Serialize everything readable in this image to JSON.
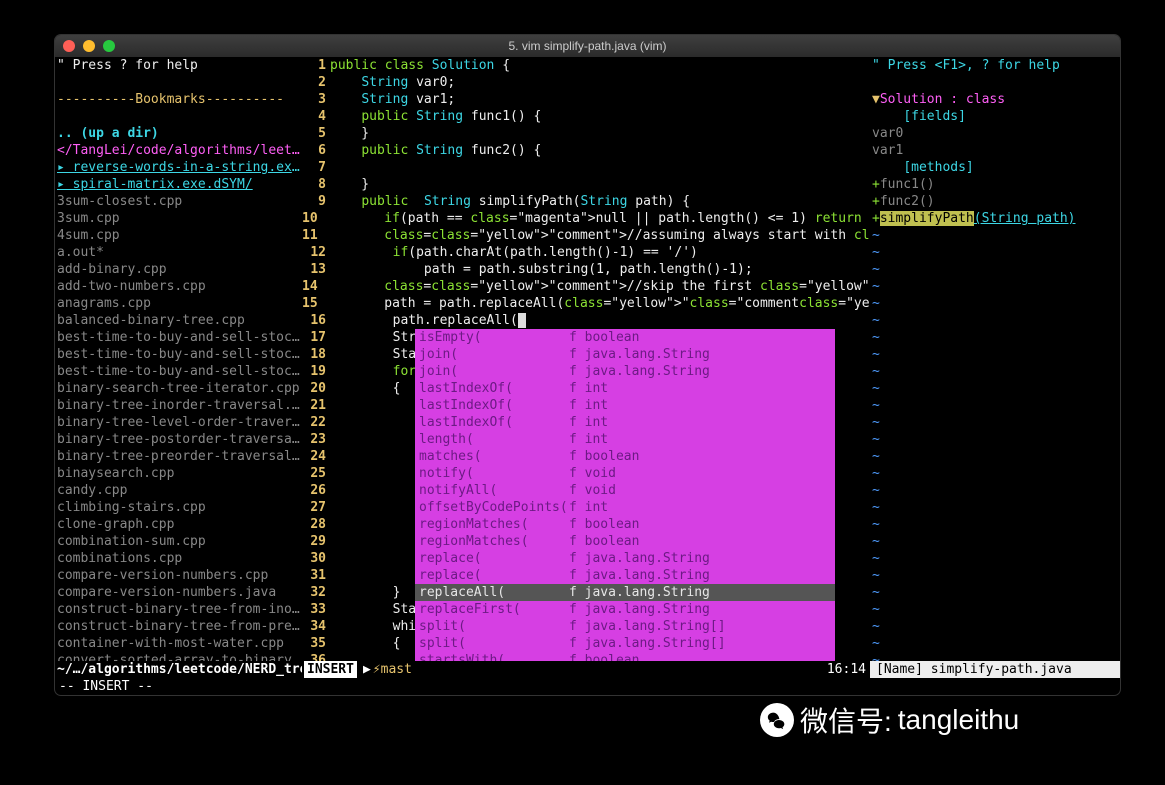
{
  "window": {
    "title": "5. vim simplify-path.java (vim)"
  },
  "nerdtree": {
    "help": "\" Press ? for help",
    "bookmarks": "  ----------Bookmarks----------",
    "up": ".. (up a dir)",
    "root": "</TangLei/code/algorithms/leetcode/",
    "dirs": [
      "▸ reverse-words-in-a-string.exe.dSY",
      "▸ spiral-matrix.exe.dSYM/"
    ],
    "files": [
      "3sum-closest.cpp",
      "3sum.cpp",
      "4sum.cpp",
      "a.out*",
      "add-binary.cpp",
      "add-two-numbers.cpp",
      "anagrams.cpp",
      "balanced-binary-tree.cpp",
      "best-time-to-buy-and-sell-stock-i",
      "best-time-to-buy-and-sell-stock-i",
      "best-time-to-buy-and-sell-stock.c",
      "binary-search-tree-iterator.cpp",
      "binary-tree-inorder-traversal.cpp",
      "binary-tree-level-order-traversal",
      "binary-tree-postorder-traversal.c",
      "binary-tree-preorder-traversal.cp",
      "binaysearch.cpp",
      "candy.cpp",
      "climbing-stairs.cpp",
      "clone-graph.cpp",
      "combination-sum.cpp",
      "combinations.cpp",
      "compare-version-numbers.cpp",
      "compare-version-numbers.java",
      "construct-binary-tree-from-inorde",
      "construct-binary-tree-from-preord",
      "container-with-most-water.cpp",
      "convert-sorted-array-to-binary-se"
    ],
    "statusline": "~/…/algorithms/leetcode/NERD_tree>"
  },
  "editor": {
    "lines": [
      "public class Solution {",
      "    String var0;",
      "    String var1;",
      "    public String func1() {",
      "    }",
      "    public String func2() {",
      "",
      "    }",
      "    public  String simplifyPath(String path) {",
      "        if(path == null || path.length() <= 1) return path;",
      "        //assuming always start with \"/\"",
      "        if(path.charAt(path.length()-1) == '/')",
      "            path = path.substring(1, path.length()-1);",
      "        //skip the first \"/\"",
      "        path = path.replaceAll(\"//\", \"/\");",
      "        path.replaceAll(",
      "        Stri",
      "        Stac",
      "        for",
      "        {",
      "",
      "",
      "",
      "",
      "",
      "",
      "",
      "",
      "",
      "",
      "",
      "        }",
      "        Stac",
      "        whil",
      "        {",
      ""
    ],
    "popup": [
      {
        "name": "isEmpty(",
        "ret": "f boolean"
      },
      {
        "name": "join(",
        "ret": "f java.lang.String"
      },
      {
        "name": "join(",
        "ret": "f java.lang.String"
      },
      {
        "name": "lastIndexOf(",
        "ret": "f int"
      },
      {
        "name": "lastIndexOf(",
        "ret": "f int"
      },
      {
        "name": "lastIndexOf(",
        "ret": "f int"
      },
      {
        "name": "length(",
        "ret": "f int"
      },
      {
        "name": "matches(",
        "ret": "f boolean"
      },
      {
        "name": "notify(",
        "ret": "f void"
      },
      {
        "name": "notifyAll(",
        "ret": "f void"
      },
      {
        "name": "offsetByCodePoints(",
        "ret": "f int"
      },
      {
        "name": "regionMatches(",
        "ret": "f boolean"
      },
      {
        "name": "regionMatches(",
        "ret": "f boolean"
      },
      {
        "name": "replace(",
        "ret": "f java.lang.String"
      },
      {
        "name": "replace(",
        "ret": "f java.lang.String"
      },
      {
        "name": "replaceAll(",
        "ret": "f java.lang.String"
      },
      {
        "name": "replaceFirst(",
        "ret": "f java.lang.String"
      },
      {
        "name": "split(",
        "ret": "f java.lang.String[]"
      },
      {
        "name": "split(",
        "ret": "f java.lang.String[]"
      },
      {
        "name": "startsWith(",
        "ret": "f boolean"
      }
    ],
    "popup_selected_index": 15,
    "status": {
      "mode": "INSERT",
      "branch": "⚡mast",
      "cursor": "16:14"
    }
  },
  "tagbar": {
    "help": "\" Press <F1>, ? for help",
    "class_head": "▼Solution : class",
    "fields_label": "[fields]",
    "fields": [
      "var0",
      "var1"
    ],
    "methods_label": "[methods]",
    "methods": [
      {
        "prefix": "+",
        "name": "func1()",
        "hl": false,
        "sig": ""
      },
      {
        "prefix": "+",
        "name": "func2()",
        "hl": false,
        "sig": ""
      },
      {
        "prefix": "+",
        "name": "simplifyPath",
        "hl": true,
        "sig": "(String path)"
      }
    ],
    "statusline": "[Name]  simplify-path.java"
  },
  "insert_mode": "-- INSERT --",
  "watermark": {
    "label": "微信号:",
    "id": "tangleithu"
  }
}
